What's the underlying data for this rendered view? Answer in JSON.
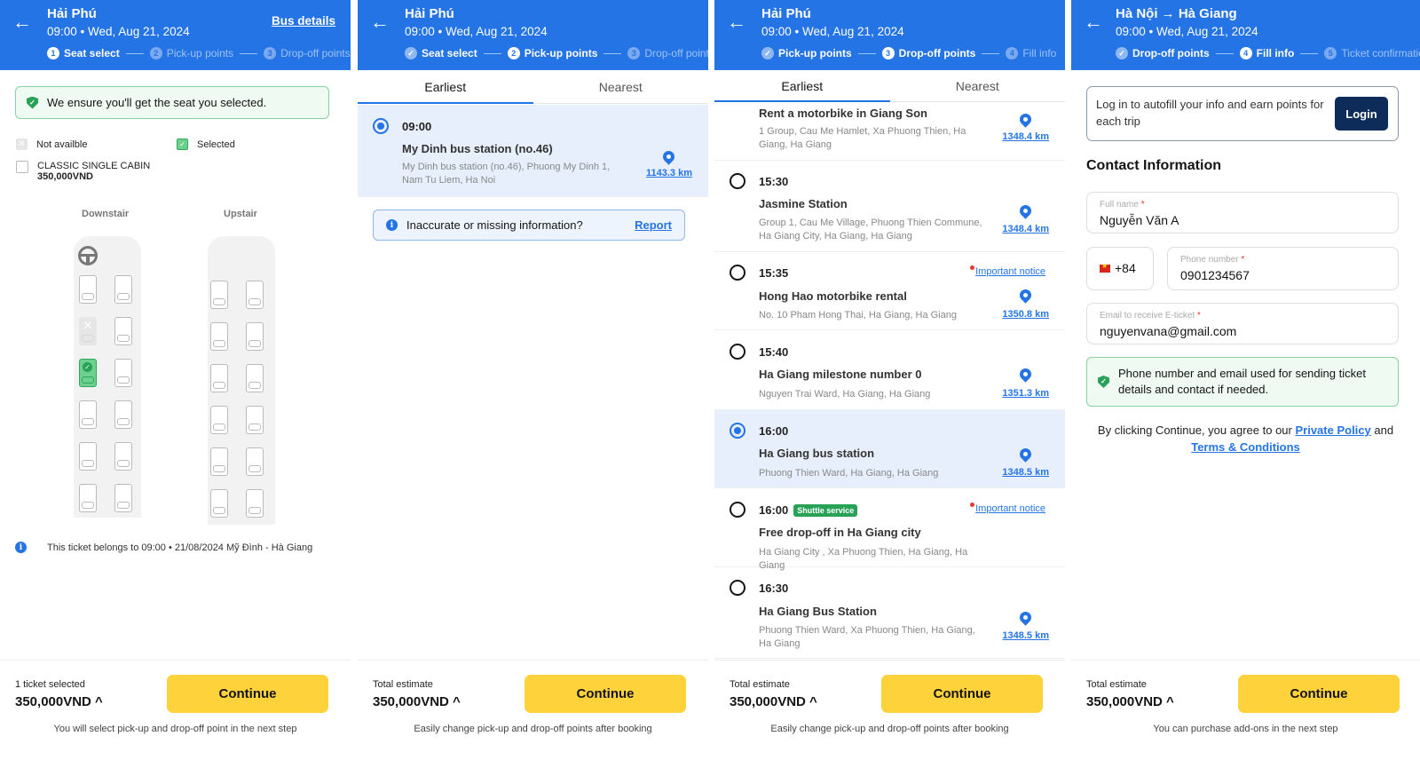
{
  "screen1": {
    "header": {
      "title": "Hải Phú",
      "subtitle": "09:00 • Wed, Aug 21, 2024",
      "link": "Bus details"
    },
    "steps": [
      {
        "num": "1",
        "label": "Seat select",
        "state": "active"
      },
      {
        "num": "2",
        "label": "Pick-up points",
        "state": "todo"
      },
      {
        "num": "3",
        "label": "Drop-off points",
        "state": "todo"
      }
    ],
    "guarantee": "We ensure you'll get the seat you selected.",
    "legend": {
      "not_available": "Not availble",
      "selected": "Selected",
      "cabin_type": "CLASSIC SINGLE CABIN",
      "cabin_price": "350,000VND"
    },
    "decks": {
      "downstair": "Downstair",
      "upstair": "Upstair"
    },
    "downstair_seats": [
      [
        "available",
        "available"
      ],
      [
        "unavailable",
        "available"
      ],
      [
        "selected",
        "available"
      ],
      [
        "available",
        "available"
      ],
      [
        "available",
        "available"
      ],
      [
        "available",
        "available"
      ]
    ],
    "upstair_seats": [
      [
        "available",
        "available"
      ],
      [
        "available",
        "available"
      ],
      [
        "available",
        "available"
      ],
      [
        "available",
        "available"
      ],
      [
        "available",
        "available"
      ],
      [
        "available",
        "available"
      ]
    ],
    "ticket_info": "This ticket belongs to 09:00 • 21/08/2024 Mỹ Đình - Hà Giang",
    "footer": {
      "label": "1 ticket selected",
      "price": "350,000VND ^",
      "button": "Continue",
      "note": "You will select pick-up and drop-off point in the next step"
    }
  },
  "screen2": {
    "header": {
      "title": "Hải Phú",
      "subtitle": "09:00 • Wed, Aug 21, 2024"
    },
    "steps": [
      {
        "num": "✓",
        "label": "Seat select",
        "state": "done"
      },
      {
        "num": "2",
        "label": "Pick-up points",
        "state": "active"
      },
      {
        "num": "3",
        "label": "Drop-off points",
        "state": "todo"
      }
    ],
    "tabs": [
      "Earliest",
      "Nearest"
    ],
    "points": [
      {
        "time": "09:00",
        "name": "My Dinh bus station (no.46)",
        "address": "My Dinh bus station (no.46), Phuong My Dinh 1, Nam Tu Liem, Ha Noi",
        "distance": "1143.3 km",
        "selected": true
      }
    ],
    "report": {
      "text": "Inaccurate or missing information?",
      "link": "Report"
    },
    "footer": {
      "label": "Total estimate",
      "price": "350,000VND ^",
      "button": "Continue",
      "note": "Easily change pick-up and drop-off points after booking"
    }
  },
  "screen3": {
    "header": {
      "title": "Hải Phú",
      "subtitle": "09:00 • Wed, Aug 21, 2024"
    },
    "steps": [
      {
        "num": "✓",
        "label": "Pick-up points",
        "state": "done"
      },
      {
        "num": "3",
        "label": "Drop-off points",
        "state": "active"
      },
      {
        "num": "4",
        "label": "Fill info",
        "state": "todo"
      }
    ],
    "tabs": [
      "Earliest",
      "Nearest"
    ],
    "points": [
      {
        "time": "",
        "name": "Rent a motorbike in Giang Son",
        "address": "1 Group, Cau Me Hamlet, Xa Phuong Thien, Ha Giang, Ha Giang",
        "distance": "1348.4 km"
      },
      {
        "time": "15:30",
        "name": "Jasmine Station",
        "address": "Group 1, Cau Me Village, Phuong Thien Commune, Ha Giang City, Ha Giang, Ha Giang",
        "distance": "1348.4 km"
      },
      {
        "time": "15:35",
        "name": "Hong Hao motorbike rental",
        "address": "No. 10 Pham Hong Thai, Ha Giang, Ha Giang",
        "distance": "1350.8 km",
        "notice": "Important notice"
      },
      {
        "time": "15:40",
        "name": "Ha Giang milestone number 0",
        "address": "Nguyen Trai Ward, Ha Giang, Ha Giang",
        "distance": "1351.3 km"
      },
      {
        "time": "16:00",
        "name": "Ha Giang bus station",
        "address": "Phuong Thien Ward, Ha Giang, Ha Giang",
        "distance": "1348.5 km",
        "selected": true
      },
      {
        "time": "16:00",
        "badge": "Shuttle service",
        "name": "Free drop-off in Ha Giang city",
        "address": "Ha Giang City , Xa Phuong Thien, Ha Giang, Ha Giang",
        "notice": "Important notice"
      },
      {
        "time": "16:30",
        "name": "Ha Giang Bus Station",
        "address": "Phuong Thien Ward, Xa Phuong Thien, Ha Giang, Ha Giang",
        "distance": "1348.5 km"
      }
    ],
    "footer": {
      "label": "Total estimate",
      "price": "350,000VND ^",
      "button": "Continue",
      "note": "Easily change pick-up and drop-off points after booking"
    }
  },
  "screen4": {
    "header": {
      "title": "Hà Nội → Hà Giang",
      "subtitle": "09:00 • Wed, Aug 21, 2024"
    },
    "steps": [
      {
        "num": "✓",
        "label": "Drop-off points",
        "state": "done"
      },
      {
        "num": "4",
        "label": "Fill info",
        "state": "active"
      },
      {
        "num": "5",
        "label": "Ticket confirmation",
        "state": "todo"
      }
    ],
    "login": {
      "text": "Log in to autofill your info and earn points for each trip",
      "button": "Login"
    },
    "section_title": "Contact Information",
    "fields": {
      "full_name": {
        "label": "Full name",
        "value": "Nguyễn Văn A"
      },
      "country_code": "+84",
      "phone": {
        "label": "Phone number",
        "value": "0901234567"
      },
      "email": {
        "label": "Email to receive E-ticket",
        "value": "nguyenvana@gmail.com"
      }
    },
    "note": "Phone number and email used for sending ticket details and contact if needed.",
    "agree": {
      "prefix": "By clicking Continue, you agree to our ",
      "policy": "Private Policy",
      "and": " and ",
      "terms": "Terms & Conditions"
    },
    "footer": {
      "label": "Total estimate",
      "price": "350,000VND ^",
      "button": "Continue",
      "note": "You can purchase add-ons in the next step"
    }
  },
  "colors": {
    "primary": "#2474e5",
    "cta": "#fdd23a",
    "success": "#27a257",
    "login_btn": "#0d2c5a"
  }
}
